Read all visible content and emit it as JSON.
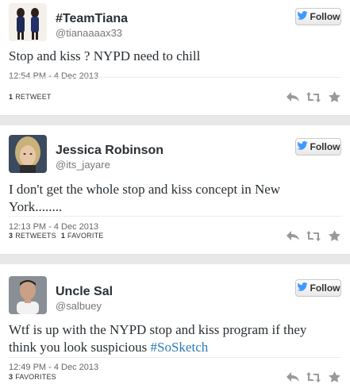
{
  "follow_label": "Follow",
  "tweets": [
    {
      "display_name": "#TeamTiana",
      "handle": "@tianaaaax33",
      "text": "Stop and kiss ? NYPD need to chill",
      "timestamp": "12:54 PM - 4 Dec 2013",
      "stats": [
        {
          "count": "1",
          "label": "RETWEET"
        }
      ]
    },
    {
      "display_name": "Jessica Robinson",
      "handle": "@its_jayare",
      "text": "I don't get the whole stop and kiss concept in New York........",
      "timestamp": "12:13 PM - 4 Dec 2013",
      "stats": [
        {
          "count": "3",
          "label": "RETWEETS"
        },
        {
          "count": "1",
          "label": "FAVORITE"
        }
      ]
    },
    {
      "display_name": "Uncle Sal",
      "handle": "@salbuey",
      "text_before": "Wtf is up with the NYPD stop and kiss program if they think you look suspicious ",
      "hashtag": "#SoSketch",
      "timestamp": "12:49 PM - 4 Dec 2013",
      "stats": [
        {
          "count": "3",
          "label": "FAVORITES"
        }
      ]
    }
  ],
  "icons": {
    "bird": "twitter-bird-icon",
    "reply": "reply-icon",
    "retweet": "retweet-icon",
    "favorite": "favorite-star-icon"
  },
  "colors": {
    "link": "#2b7bb9",
    "bird": "#4099ff",
    "action_gray": "#999999"
  }
}
